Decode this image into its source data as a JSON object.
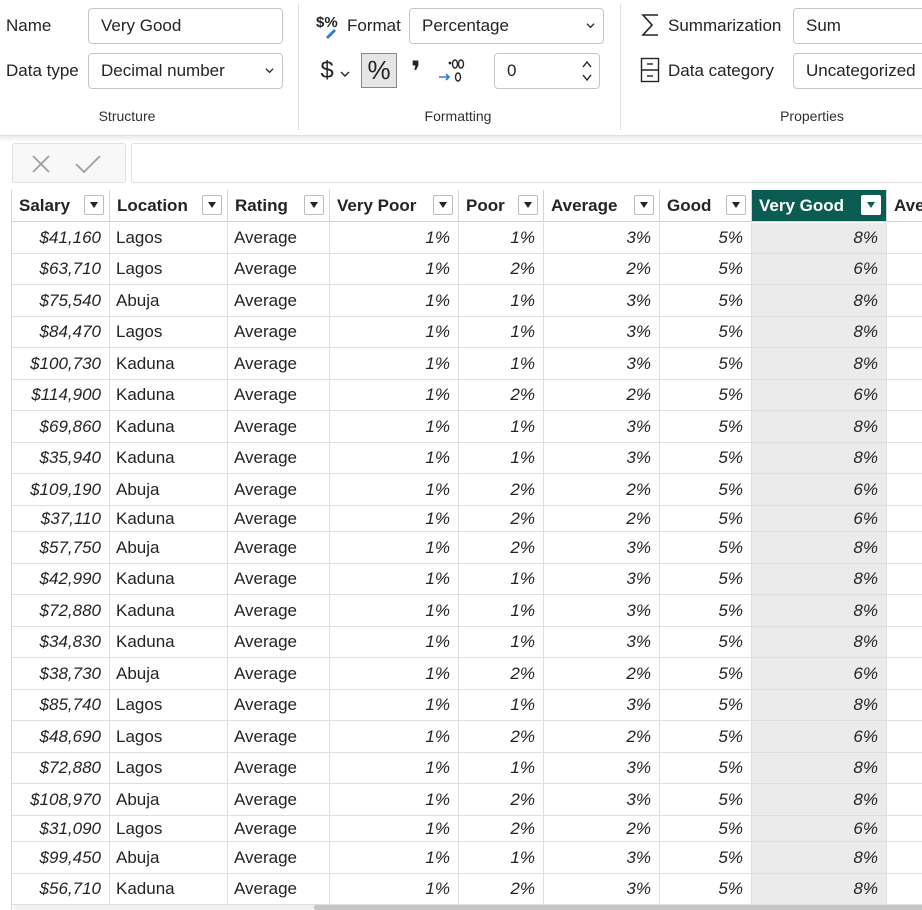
{
  "ribbon": {
    "structure": {
      "name_label": "Name",
      "name_value": "Very Good",
      "datatype_label": "Data type",
      "datatype_value": "Decimal number",
      "group_label": "Structure"
    },
    "formatting": {
      "format_label": "Format",
      "format_value": "Percentage",
      "currency_symbol": "$",
      "percent_symbol": "%",
      "comma_symbol": "❜",
      "decimal_places": "0",
      "group_label": "Formatting"
    },
    "properties": {
      "summarization_label": "Summarization",
      "summarization_value": "Sum",
      "category_label": "Data category",
      "category_value": "Uncategorized",
      "group_label": "Properties"
    }
  },
  "table": {
    "selected_column": "Very Good",
    "accent_color": "#0b5c52",
    "columns": [
      "Salary",
      "Location",
      "Rating",
      "Very Poor",
      "Poor",
      "Average",
      "Good",
      "Very Good",
      "Ave"
    ],
    "rows": [
      [
        "$41,160",
        "Lagos",
        "Average",
        "1%",
        "1%",
        "3%",
        "5%",
        "8%"
      ],
      [
        "$63,710",
        "Lagos",
        "Average",
        "1%",
        "2%",
        "2%",
        "5%",
        "6%"
      ],
      [
        "$75,540",
        "Abuja",
        "Average",
        "1%",
        "1%",
        "3%",
        "5%",
        "8%"
      ],
      [
        "$84,470",
        "Lagos",
        "Average",
        "1%",
        "1%",
        "3%",
        "5%",
        "8%"
      ],
      [
        "$100,730",
        "Kaduna",
        "Average",
        "1%",
        "1%",
        "3%",
        "5%",
        "8%"
      ],
      [
        "$114,900",
        "Kaduna",
        "Average",
        "1%",
        "2%",
        "2%",
        "5%",
        "6%"
      ],
      [
        "$69,860",
        "Kaduna",
        "Average",
        "1%",
        "1%",
        "3%",
        "5%",
        "8%"
      ],
      [
        "$35,940",
        "Kaduna",
        "Average",
        "1%",
        "1%",
        "3%",
        "5%",
        "8%"
      ],
      [
        "$109,190",
        "Abuja",
        "Average",
        "1%",
        "2%",
        "2%",
        "5%",
        "6%"
      ],
      [
        "$37,110",
        "Kaduna",
        "Average",
        "1%",
        "2%",
        "2%",
        "5%",
        "6%"
      ],
      [
        "$57,750",
        "Abuja",
        "Average",
        "1%",
        "2%",
        "3%",
        "5%",
        "8%"
      ],
      [
        "$42,990",
        "Kaduna",
        "Average",
        "1%",
        "1%",
        "3%",
        "5%",
        "8%"
      ],
      [
        "$72,880",
        "Kaduna",
        "Average",
        "1%",
        "1%",
        "3%",
        "5%",
        "8%"
      ],
      [
        "$34,830",
        "Kaduna",
        "Average",
        "1%",
        "1%",
        "3%",
        "5%",
        "8%"
      ],
      [
        "$38,730",
        "Abuja",
        "Average",
        "1%",
        "2%",
        "2%",
        "5%",
        "6%"
      ],
      [
        "$85,740",
        "Lagos",
        "Average",
        "1%",
        "1%",
        "3%",
        "5%",
        "8%"
      ],
      [
        "$48,690",
        "Lagos",
        "Average",
        "1%",
        "2%",
        "2%",
        "5%",
        "6%"
      ],
      [
        "$72,880",
        "Lagos",
        "Average",
        "1%",
        "1%",
        "3%",
        "5%",
        "8%"
      ],
      [
        "$108,970",
        "Abuja",
        "Average",
        "1%",
        "2%",
        "3%",
        "5%",
        "8%"
      ],
      [
        "$31,090",
        "Lagos",
        "Average",
        "1%",
        "2%",
        "2%",
        "5%",
        "6%"
      ],
      [
        "$99,450",
        "Abuja",
        "Average",
        "1%",
        "1%",
        "3%",
        "5%",
        "8%"
      ],
      [
        "$56,710",
        "Kaduna",
        "Average",
        "1%",
        "2%",
        "3%",
        "5%",
        "8%"
      ]
    ]
  }
}
